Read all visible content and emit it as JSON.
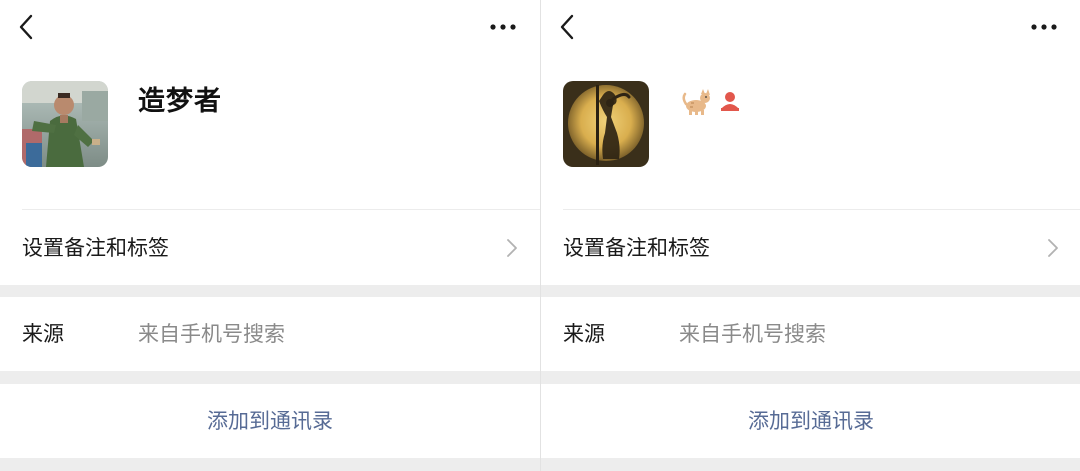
{
  "left_screen": {
    "nickname": "造梦者",
    "remark_row_label": "设置备注和标签",
    "source_label": "来源",
    "source_value": "来自手机号搜索",
    "add_button_label": "添加到通讯录"
  },
  "right_screen": {
    "nickname_icons": [
      "cat-emoji-icon",
      "person-badge-icon"
    ],
    "remark_row_label": "设置备注和标签",
    "source_label": "来源",
    "source_value": "来自手机号搜索",
    "add_button_label": "添加到通讯录"
  },
  "colors": {
    "link_blue": "#576b95",
    "background_gray": "#ededed",
    "secondary_text": "#8a8a8a"
  }
}
